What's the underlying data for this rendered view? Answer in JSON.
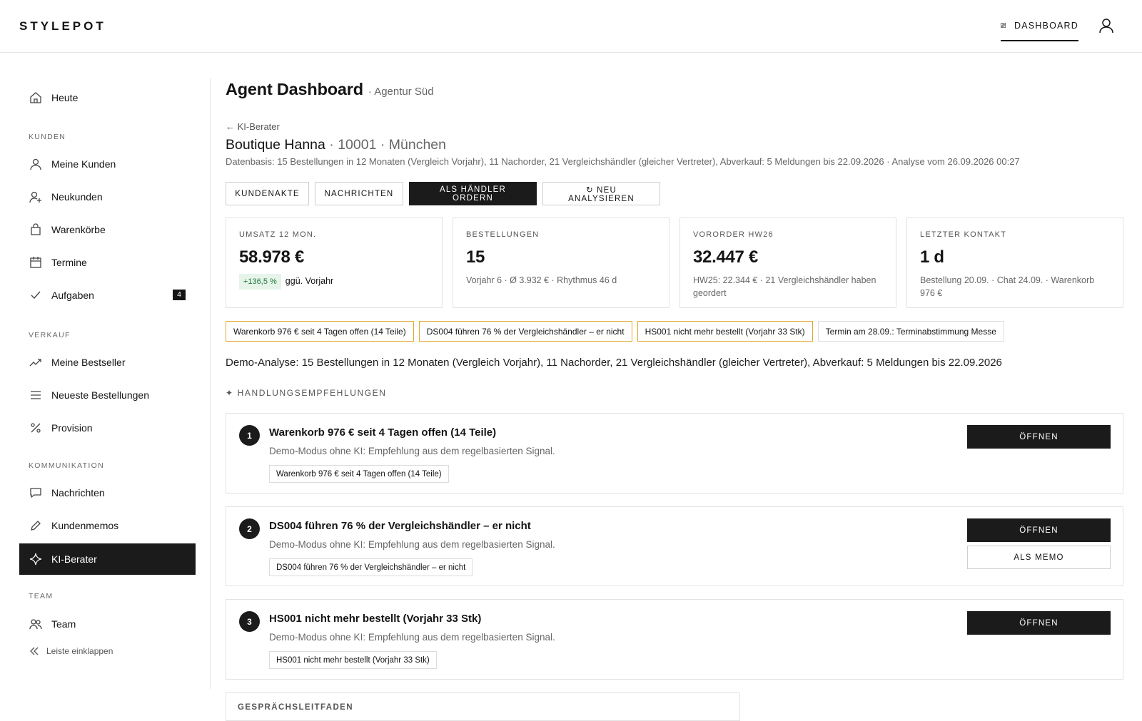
{
  "header": {
    "logo": "STYLEPOT",
    "dashboard_label": "DASHBOARD"
  },
  "sidebar": {
    "today": "Heute",
    "sections": {
      "kunden": "KUNDEN",
      "verkauf": "VERKAUF",
      "kommunikation": "KOMMUNIKATION",
      "team": "TEAM"
    },
    "items": {
      "meine_kunden": "Meine Kunden",
      "neukunden": "Neukunden",
      "warenkoerbe": "Warenkörbe",
      "termine": "Termine",
      "aufgaben": "Aufgaben",
      "aufgaben_count": "4",
      "bestseller": "Meine Bestseller",
      "bestellungen": "Neueste Bestellungen",
      "provision": "Provision",
      "nachrichten": "Nachrichten",
      "kundenmemos": "Kundenmemos",
      "ki_berater": "KI-Berater",
      "team": "Team"
    },
    "collapse_label": "Leiste einklappen"
  },
  "page": {
    "title": "Agent Dashboard",
    "subtitle": "· Agentur Süd",
    "back_link": "← KI-Berater",
    "customer_name": "Boutique Hanna",
    "customer_meta": "· 10001 · München",
    "data_basis": "Datenbasis: 15 Bestellungen in 12 Monaten (Vergleich Vorjahr), 11 Nachorder, 21 Vergleichshändler (gleicher Vertreter), Abverkauf: 5 Meldungen bis 22.09.2026 · Analyse vom 26.09.2026 00:27"
  },
  "actions": {
    "kundenakte": "KUNDENAKTE",
    "nachrichten": "NACHRICHTEN",
    "als_haendler": "ALS HÄNDLER ORDERN",
    "neu_analysieren": "↻ NEU ANALYSIEREN"
  },
  "kpis": [
    {
      "label": "UMSATZ 12 MON.",
      "value": "58.978 €",
      "delta": "+136,5 %",
      "sub": "ggü. Vorjahr"
    },
    {
      "label": "BESTELLUNGEN",
      "value": "15",
      "sub": "Vorjahr 6 · Ø 3.932 € · Rhythmus 46 d"
    },
    {
      "label": "VORORDER HW26",
      "value": "32.447 €",
      "sub": "HW25: 22.344 € · 21 Vergleichshändler haben geordert"
    },
    {
      "label": "LETZTER KONTAKT",
      "value": "1 d",
      "sub": "Bestellung 20.09. · Chat 24.09. · Warenkorb 976 €"
    }
  ],
  "chips": [
    "Warenkorb 976 € seit 4 Tagen offen (14 Teile)",
    "DS004 führen 76 % der Vergleichshändler – er nicht",
    "HS001 nicht mehr bestellt (Vorjahr 33 Stk)",
    "Termin am 28.09.: Terminabstimmung Messe"
  ],
  "demo_text": "Demo-Analyse: 15 Bestellungen in 12 Monaten (Vergleich Vorjahr), 11 Nachorder, 21 Vergleichshändler (gleicher Vertreter), Abverkauf: 5 Meldungen bis 22.09.2026",
  "recommendations_header": "✦ HANDLUNGSEMPFEHLUNGEN",
  "recommendations": [
    {
      "num": "1",
      "title": "Warenkorb 976 € seit 4 Tagen offen (14 Teile)",
      "desc": "Demo-Modus ohne KI: Empfehlung aus dem regelbasierten Signal.",
      "tag": "Warenkorb 976 € seit 4 Tagen offen (14 Teile)",
      "open": "ÖFFNEN"
    },
    {
      "num": "2",
      "title": "DS004 führen 76 % der Vergleichshändler – er nicht",
      "desc": "Demo-Modus ohne KI: Empfehlung aus dem regelbasierten Signal.",
      "tag": "DS004 führen 76 % der Vergleichshändler – er nicht",
      "open": "ÖFFNEN",
      "memo": "ALS MEMO"
    },
    {
      "num": "3",
      "title": "HS001 nicht mehr bestellt (Vorjahr 33 Stk)",
      "desc": "Demo-Modus ohne KI: Empfehlung aus dem regelbasierten Signal.",
      "tag": "HS001 nicht mehr bestellt (Vorjahr 33 Stk)",
      "open": "ÖFFNEN"
    }
  ],
  "guide_title": "GESPRÄCHSLEITFADEN",
  "colors": {
    "dark": "#1b1b1b",
    "warning_border": "#e0a82e",
    "positive_bg": "#e6f4ea",
    "positive_text": "#1e7a3b"
  }
}
